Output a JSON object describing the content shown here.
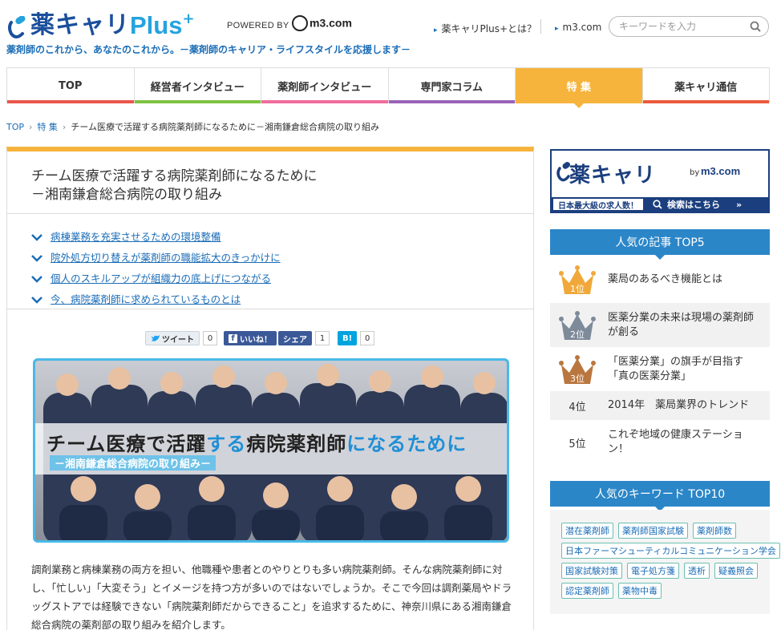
{
  "header": {
    "brand": "薬キャリ",
    "brand_plus": "Plus",
    "powered_by": "POWERED BY",
    "m3": "m3.com",
    "tagline": "薬剤師のこれから、あなたのこれから。－薬剤師のキャリア・ライフスタイルを応援します－",
    "link_about": "薬キャリPlus+とは？",
    "link_m3": "m3.com",
    "search_placeholder": "キーワードを入力"
  },
  "nav": {
    "items": [
      {
        "label": "TOP",
        "color": "#e9574b"
      },
      {
        "label": "経営者インタビュー",
        "color": "#7fc241"
      },
      {
        "label": "薬剤師インタビュー",
        "color": "#ef6d9c"
      },
      {
        "label": "専門家コラム",
        "color": "#9a63b8"
      },
      {
        "label": "特 集",
        "color": "#f6b43c"
      },
      {
        "label": "薬キャリ通信",
        "color": "#ea5a3c"
      }
    ]
  },
  "breadcrumb": {
    "top": "TOP",
    "section": "特 集",
    "current": "チーム医療で活躍する病院薬剤師になるために－湘南鎌倉総合病院の取り組み"
  },
  "article": {
    "title_line1": "チーム医療で活躍する病院薬剤師になるために",
    "title_line2": "－湘南鎌倉総合病院の取り組み",
    "toc": [
      "病棟業務を充実させるための環境整備",
      "院外処方切り替えが薬剤師の職能拡大のきっかけに",
      "個人のスキルアップが組織力の底上げにつながる",
      "今、病院薬剤師に求められているものとは"
    ],
    "share": {
      "tweet": "ツイート",
      "tweet_count": "0",
      "like": "いいね！",
      "share": "シェア",
      "fb_count": "1",
      "hatena": "B!",
      "hatena_count": "0"
    },
    "hero_title_a": "チーム医療で活躍",
    "hero_title_b": "する",
    "hero_title_c": "病院薬剤師",
    "hero_title_d": "になるために",
    "hero_sub": "－湘南鎌倉総合病院の取り組み－",
    "body": "調剤業務と病棟業務の両方を担い、他職種や患者とのやりとりも多い病院薬剤師。そんな病院薬剤師に対し、「忙しい」「大変そう」とイメージを持つ方が多いのではないでしょうか。そこで今回は調剤薬局やドラッグストアでは経験できない「病院薬剤師だからできること」を追求するために、神奈川県にある湘南鎌倉総合病院の薬剤部の取り組みを紹介します。"
  },
  "sidebar": {
    "banner_name": "薬キャリ",
    "banner_by": "by",
    "banner_m3": "m3.com",
    "banner_left": "日本最大級の求人数！",
    "banner_right": "検索はこちら",
    "popular_title": "人気の記事 TOP5",
    "ranking": [
      {
        "rank": "1位",
        "text": "薬局のあるべき機能とは",
        "crown": "#f0a83a"
      },
      {
        "rank": "2位",
        "text": "医薬分業の未来は現場の薬剤師が創る",
        "crown": "#7d8a9a"
      },
      {
        "rank": "3位",
        "text": "「医薬分業」の旗手が目指す「真の医薬分業」",
        "crown": "#b9773f"
      },
      {
        "rank": "4位",
        "text": "2014年　薬局業界のトレンド"
      },
      {
        "rank": "5位",
        "text": "これぞ地域の健康ステーション！"
      }
    ],
    "keyword_title": "人気のキーワード TOP10",
    "keywords": [
      "潜在薬剤師",
      "薬剤師国家試験",
      "薬剤師数",
      "日本ファーマシューティカルコミュニケーション学会",
      "国家試験対策",
      "電子処方箋",
      "透析",
      "疑義照会",
      "認定薬剤師",
      "薬物中毒"
    ]
  }
}
